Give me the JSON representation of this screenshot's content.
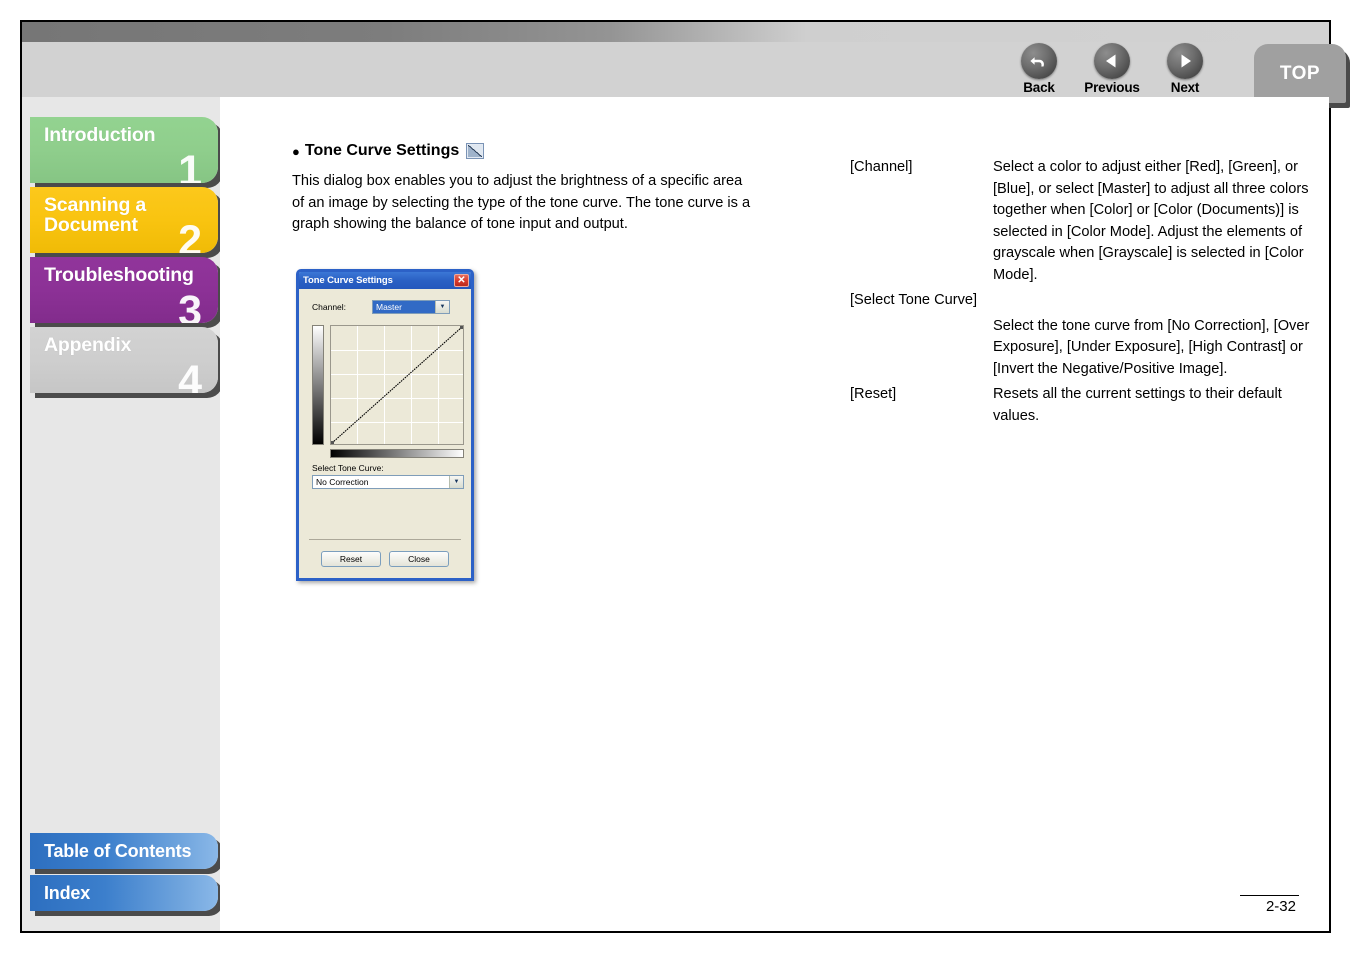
{
  "header": {
    "nav_buttons": [
      {
        "label": "Back",
        "icon": "back-arrow-icon"
      },
      {
        "label": "Previous",
        "icon": "left-triangle-icon"
      },
      {
        "label": "Next",
        "icon": "right-triangle-icon"
      }
    ],
    "top_button": "TOP"
  },
  "sidebar": {
    "chapters": [
      {
        "label": "Introduction",
        "number": "1",
        "color": "#8fce8c"
      },
      {
        "label": "Scanning a Document",
        "number": "2",
        "color": "#f9c410"
      },
      {
        "label": "Troubleshooting",
        "number": "3",
        "color": "#8c3196"
      },
      {
        "label": "Appendix",
        "number": "4",
        "color": "#cecece"
      }
    ],
    "bottom_links": [
      {
        "label": "Table of Contents"
      },
      {
        "label": "Index"
      }
    ]
  },
  "content": {
    "section_bullet": "●",
    "section_title": "Tone Curve Settings",
    "section_icon": "tone-curve-icon",
    "intro_paragraph": "This dialog box enables you to adjust the brightness of a specific area of an image by selecting the type of the tone curve. The tone curve is a graph showing the balance of tone input and output.",
    "descriptions": [
      {
        "term": "[Channel]",
        "definition": "Select a color to adjust either [Red], [Green], or [Blue], or select [Master] to adjust all three colors together when [Color] or [Color (Documents)] is selected in [Color Mode]. Adjust the elements of grayscale when [Grayscale] is selected in [Color Mode].",
        "stacked": false
      },
      {
        "term": "[Select Tone Curve]",
        "definition": "Select the tone curve from [No Correction], [Over Exposure], [Under Exposure], [High Contrast] or [Invert the Negative/Positive Image].",
        "stacked": true
      },
      {
        "term": "[Reset]",
        "definition": "Resets all the current settings to their default values.",
        "stacked": false
      }
    ]
  },
  "dialog": {
    "title": "Tone Curve Settings",
    "close_glyph": "✕",
    "channel_label": "Channel:",
    "channel_value": "Master",
    "select_tone_curve_label": "Select Tone Curve:",
    "select_tone_curve_value": "No Correction",
    "reset_button": "Reset",
    "close_button": "Close",
    "graph": {
      "grid_divisions": 4,
      "curve": "linear-identity"
    }
  },
  "footer": {
    "page_number": "2-32"
  }
}
